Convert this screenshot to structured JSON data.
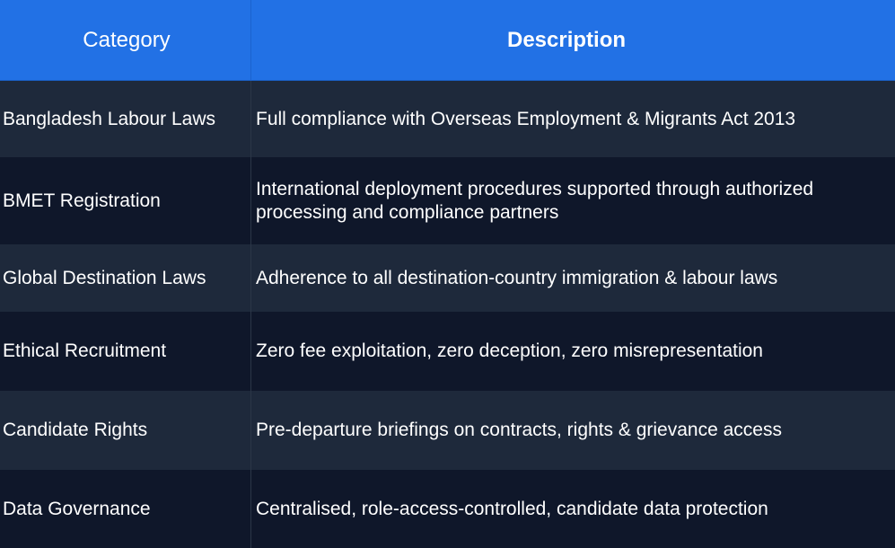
{
  "table": {
    "headers": {
      "category": "Category",
      "description": "Description"
    },
    "rows": [
      {
        "category": "Bangladesh Labour Laws",
        "description": "Full compliance with Overseas Employment & Migrants Act 2013"
      },
      {
        "category": "BMET Registration",
        "description": "International deployment procedures supported through authorized processing and compliance partners"
      },
      {
        "category": "Global Destination Laws",
        "description": "Adherence to all destination-country immigration & labour laws"
      },
      {
        "category": "Ethical Recruitment",
        "description": "Zero fee exploitation, zero deception, zero misrepresentation"
      },
      {
        "category": "Candidate Rights",
        "description": "Pre-departure briefings on contracts, rights & grievance access"
      },
      {
        "category": "Data Governance",
        "description": "Centralised, role-access-controlled, candidate data protection"
      }
    ]
  },
  "colors": {
    "header_bg": "#2271e5",
    "row_dark": "#0f172a",
    "row_light": "#1e293b",
    "text": "#ffffff"
  }
}
